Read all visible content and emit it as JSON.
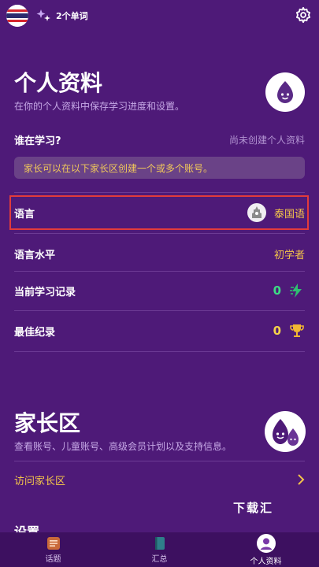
{
  "topbar": {
    "flag_icon": "thailand-flag-icon",
    "words_icon": "sparkle-icon",
    "words_label": "2个单词",
    "settings_icon": "gear-icon"
  },
  "profile": {
    "title": "个人资料",
    "subtitle": "在你的个人资料中保存学习进度和设置。",
    "who_learns_label": "谁在学习?",
    "who_learns_value": "尚未创建个人资料",
    "info_text": "家长可以在以下家长区创建一个或多个账号。",
    "language_label": "语言",
    "language_value": "泰国语",
    "level_label": "语言水平",
    "level_value": "初学者",
    "current_record_label": "当前学习记录",
    "current_record_value": "0",
    "best_record_label": "最佳纪录",
    "best_record_value": "0"
  },
  "parent_zone": {
    "title": "家长区",
    "subtitle": "查看账号、儿童账号、高级会员计划以及支持信息。",
    "visit_label": "访问家长区"
  },
  "settings": {
    "heading": "设置"
  },
  "watermark": "下载汇",
  "tabs": [
    {
      "label": "话题",
      "icon": "topics-icon"
    },
    {
      "label": "汇总",
      "icon": "notebook-icon"
    },
    {
      "label": "个人资料",
      "icon": "profile-icon"
    }
  ],
  "colors": {
    "background": "#4e1a78",
    "gold": "#f4c54a",
    "green": "#3ddc84",
    "highlight": "#e23b3b"
  }
}
